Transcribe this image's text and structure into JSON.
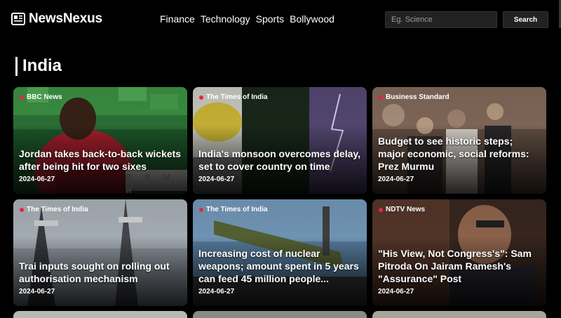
{
  "brand": {
    "name": "NewsNexus",
    "icon": "newspaper-icon"
  },
  "nav": {
    "links": [
      "Finance",
      "Technology",
      "Sports",
      "Bollywood"
    ]
  },
  "search": {
    "placeholder": "Eg. Science",
    "button_label": "Search"
  },
  "section": {
    "title": "India"
  },
  "cards": [
    {
      "source": "BBC News",
      "title": "Jordan takes back-to-back wickets after being hit for two sixes",
      "date": "2024-06-27",
      "overlay_text": "6, 6, W, W"
    },
    {
      "source": "The Times of India",
      "title": "India's monsoon overcomes delay, set to cover country on time",
      "date": "2024-06-27"
    },
    {
      "source": "Business Standard",
      "title": "Budget to see historic steps; major economic, social reforms: Prez Murmu",
      "date": "2024-06-27"
    },
    {
      "source": "The Times of India",
      "title": "Trai inputs sought on rolling out authorisation mechanism",
      "date": "2024-06-27"
    },
    {
      "source": "The Times of India",
      "title": "Increasing cost of nuclear weapons; amount spent in 5 years can feed 45 million people...",
      "date": "2024-06-27"
    },
    {
      "source": "NDTV News",
      "title": "\"His View, Not Congress's\": Sam Pitroda On Jairam Ramesh's \"Assurance\" Post",
      "date": "2024-06-27"
    }
  ],
  "colors": {
    "background": "#000000",
    "source_dot": "#e8263a",
    "input_bg": "#222222"
  }
}
